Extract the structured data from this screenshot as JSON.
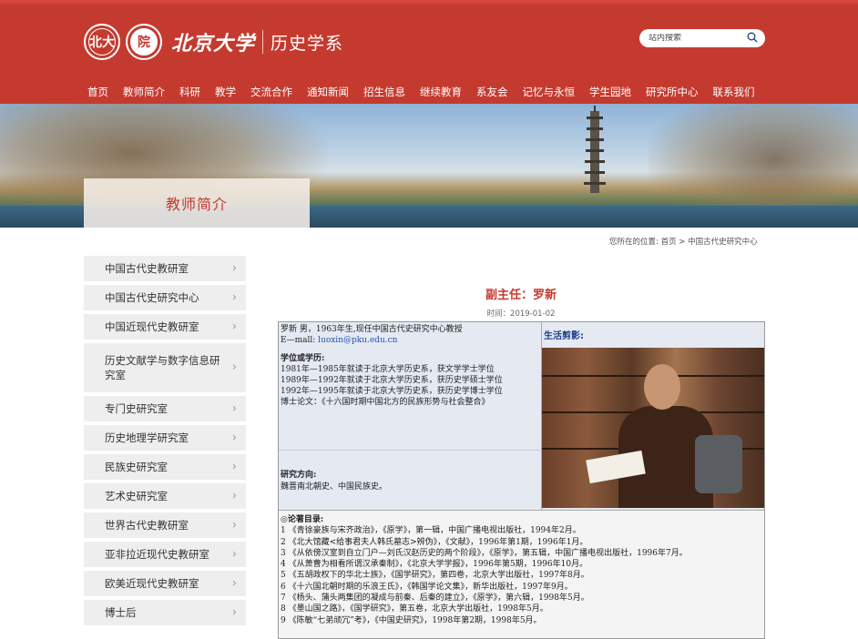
{
  "header": {
    "university_name": "北京大学",
    "department_name": "历史学系",
    "seal_glyphs": [
      "北大",
      "院"
    ],
    "search": {
      "placeholder": "站内搜索"
    },
    "nav": [
      "首页",
      "教师简介",
      "科研",
      "教学",
      "交流合作",
      "通知新闻",
      "招生信息",
      "继续教育",
      "系友会",
      "记忆与永恒",
      "学生园地",
      "研究所中心",
      "联系我们"
    ]
  },
  "banner": {
    "section_title": "教师简介"
  },
  "breadcrumb": "您所在的位置: 首页 > 中国古代史研究中心",
  "sidebar": {
    "items": [
      "中国古代史教研室",
      "中国古代史研究中心",
      "中国近现代史教研室",
      "历史文献学与数字信息研究室",
      "专门史研究室",
      "历史地理学研究室",
      "民族史研究室",
      "艺术史研究室",
      "世界古代史教研室",
      "亚非拉近现代史教研室",
      "欧美近现代史教研室",
      "博士后"
    ]
  },
  "article": {
    "title": "副主任：罗新",
    "date": "时间：2019-01-02",
    "bio_line1": "罗新 男，1963年生,现任中国古代史研究中心教授",
    "email_label": "E—mall:",
    "email": "luoxin@pku.edu.cn",
    "education_heading": "学位或学历:",
    "education": [
      "1981年—1985年就读于北京大学历史系，获文学学士学位",
      "1989年—1992年就读于北京大学历史系，获历史学硕士学位",
      "1992年—1995年就读于北京大学历史系，获历史学博士学位",
      "博士论文：《十六国时期中国北方的民族形势与社会整合》"
    ],
    "research_heading": "研究方向:",
    "research": "魏晋南北朝史、中国民族史。",
    "photo_label": "生活剪影:",
    "works_heading": "◎论著目录:",
    "works": [
      "1 《青徐豪族与宋齐政治》，《原学》，第一辑，中国广播电视出版社，1994年2月。",
      "2 《北大馆藏<给事君夫人韩氏墓志>辨伪》，《文献》，1996年第1期，1996年1月。",
      "3 《从依傍汉室到自立门户—刘氏汉赵历史的两个阶段》，《原学》，第五辑，中国广播电视出版社，1996年7月。",
      "4 《从萧曹为相看所谓汉承秦制》，《北京大学学报》，1996年第5期，1996年10月。",
      "5 《五胡政权下的华北士族》，《国学研究》，第四卷，北京大学出版社，1997年8月。",
      "6 《十六国北朝时期的乐浪王氏》，《韩国学论文集》，新华出版社，1997年9月。",
      "7 《杨头、蒲头两集团的凝成与前秦、后秦的建立》，《原学》，第六辑，1998年5月。",
      "8 《墨山国之路》，《国学研究》，第五卷，北京大学出版社，1998年5月。",
      "9 《陈敏“七弟顽冗”考》，《中国史研究》，1998年第2期，1998年5月。"
    ]
  },
  "colors": {
    "brand_red": "#c53a2f",
    "sidebar_bg": "#eeeeee",
    "link_blue": "#2255aa"
  }
}
